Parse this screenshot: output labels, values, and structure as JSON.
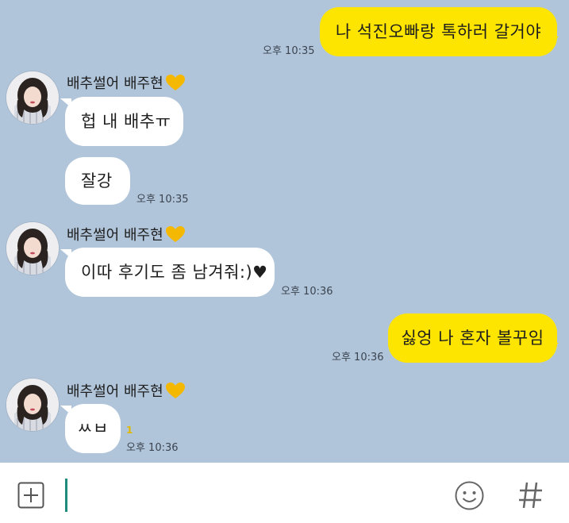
{
  "colors": {
    "background": "#b1c5da",
    "my_bubble": "#fee500",
    "their_bubble": "#ffffff",
    "heart": "#f5b800",
    "caret": "#1f8b7c"
  },
  "messages": [
    {
      "from": "me",
      "text": "나 석진오빠랑 톡하러 갈거야",
      "time": "오후 10:35"
    },
    {
      "from": "them",
      "sender": "배추썰어 배주현",
      "sender_icon": "heart-icon",
      "text": "헙 내 배추ㅠ"
    },
    {
      "from": "them",
      "text": "잘강",
      "time": "오후 10:35"
    },
    {
      "from": "them",
      "sender": "배추썰어 배주현",
      "sender_icon": "heart-icon",
      "text": "이따 후기도 좀 남겨줘:)♥",
      "time": "오후 10:36"
    },
    {
      "from": "me",
      "text": "싫엉 나 혼자 볼꾸임",
      "time": "오후 10:36"
    },
    {
      "from": "them",
      "sender": "배추썰어 배주현",
      "sender_icon": "heart-icon",
      "text": "ㅆㅂ",
      "unread": "1",
      "time": "오후 10:36"
    }
  ],
  "input_bar": {
    "plus_icon": "plus-square-icon",
    "emoji_icon": "smiley-icon",
    "hash_icon": "hash-icon"
  }
}
